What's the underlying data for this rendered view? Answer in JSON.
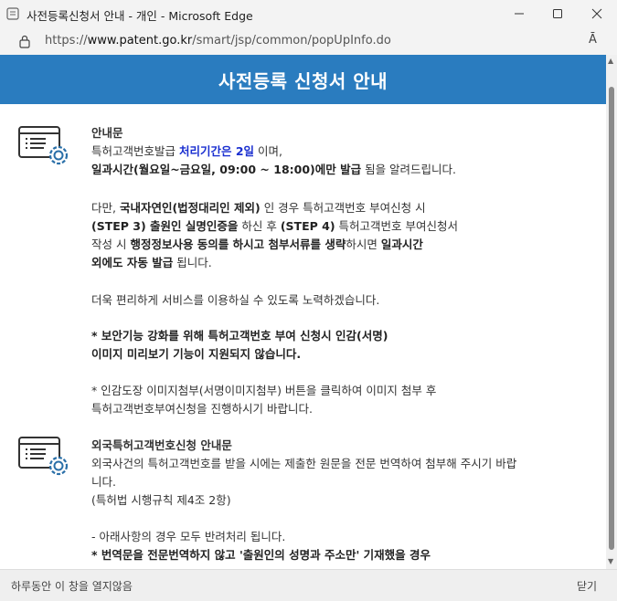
{
  "window": {
    "title": "사전등록신청서 안내 - 개인 - Microsoft Edge",
    "url_prefix": "https://",
    "url_domain": "www.patent.go.kr",
    "url_path": "/smart/jsp/common/popUpInfo.do",
    "read_aloud_label": "Ā"
  },
  "header": {
    "title": "사전등록 신청서 안내"
  },
  "section1": {
    "heading": "안내문",
    "p1_a": "특허고객번호발급 ",
    "p1_b": "처리기간은 2일",
    "p1_c": " 이며,",
    "p1_line2_bold": "일과시간(월요일~금요일, 09:00 ~ 18:00)에만 발급",
    "p1_line2_rest": " 됨을 알려드립니다.",
    "p2_l1_a": "다만, ",
    "p2_l1_b": "국내자연인(법정대리인 제외)",
    "p2_l1_c": " 인 경우 특허고객번호 부여신청 시",
    "p2_l2_a": "(STEP 3) 출원인 실명인증을",
    "p2_l2_b": " 하신 후 ",
    "p2_l2_c": "(STEP 4)",
    "p2_l2_d": " 특허고객번호 부여신청서",
    "p2_l3_a": "작성 시 ",
    "p2_l3_b": "행정정보사용 동의를 하시고 첨부서류를 생략",
    "p2_l3_c": "하시면 ",
    "p2_l3_d": "일과시간",
    "p2_l4_a": "외에도 자동 발급",
    "p2_l4_b": " 됩니다.",
    "p3": "더욱 편리하게 서비스를 이용하실 수 있도록 노력하겠습니다.",
    "p4_l1": "* 보안기능 강화를 위해 특허고객번호 부여 신청시 인감(서명)",
    "p4_l2": "이미지 미리보기 기능이 지원되지 않습니다.",
    "p5_l1": "* 인감도장 이미지첨부(서명이미지첨부) 버튼을 클릭하여 이미지 첨부 후",
    "p5_l2": "특허고객번호부여신청을 진행하시기 바랍니다."
  },
  "section2": {
    "heading": "외국특허고객번호신청 안내문",
    "p1_l1": "외국사건의 특허고객번호를 받을 시에는 제출한 원문을 전문 번역하여 첨부해 주시기 바랍",
    "p1_l2": "니다.",
    "p1_l3": "(특허법 시행규칙 제4조 2항)",
    "p2": "- 아래사항의 경우 모두 반려처리 됩니다.",
    "p3": "* 번역문을 전문번역하지 않고 '출원인의 성명과 주소만' 기재했을 경우"
  },
  "footer": {
    "dont_show_today": "하루동안 이 창을 열지않음",
    "close": "닫기"
  },
  "colors": {
    "header_band": "#2a7cbf",
    "highlight_blue": "#1a2fd0",
    "footer_bg": "#efefef"
  }
}
